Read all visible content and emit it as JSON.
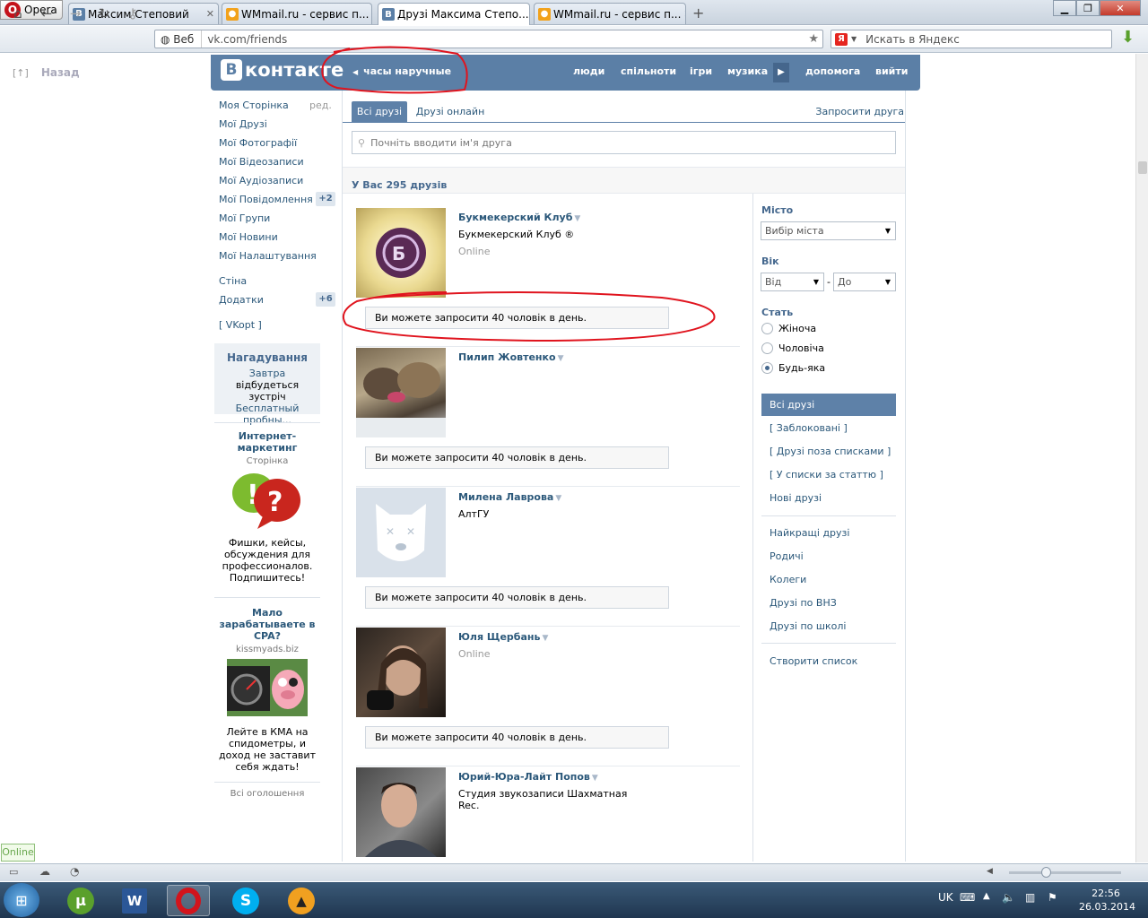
{
  "browser": {
    "opera_label": "Opera",
    "tabs": [
      {
        "title": "Максим Степовий",
        "icon": "vk"
      },
      {
        "title": "WMmail.ru - сервис п...",
        "icon": "wmmail"
      },
      {
        "title": "Друзі Максима Степо...",
        "icon": "vk"
      },
      {
        "title": "WMmail.ru - сервис п...",
        "icon": "wmmail"
      }
    ],
    "veb_label": "Веб",
    "url": "vk.com/friends",
    "search_placeholder": "Искать в Яндекс",
    "back_text": "Назад"
  },
  "vk": {
    "logo": "контакте",
    "search_query": "часы наручные",
    "topnav": [
      "люди",
      "спільноти",
      "ігри",
      "музика",
      "допомога",
      "вийти"
    ],
    "left_menu": [
      {
        "label": "Моя Сторінка",
        "extra": "ред."
      },
      {
        "label": "Мої Друзі"
      },
      {
        "label": "Мої Фотографії"
      },
      {
        "label": "Мої Відеозаписи"
      },
      {
        "label": "Мої Аудіозаписи"
      },
      {
        "label": "Мої Повідомлення",
        "count": "+2"
      },
      {
        "label": "Мої Групи"
      },
      {
        "label": "Мої Новини"
      },
      {
        "label": "Мої Налаштування"
      }
    ],
    "left_menu2": [
      {
        "label": "Стіна"
      },
      {
        "label": "Додатки",
        "count": "+6"
      },
      {
        "label": "[ VKopt ]"
      }
    ],
    "reminder": {
      "title": "Нагадування",
      "link1": "Завтра",
      "text": "відбудеться зустріч",
      "link2": "Бесплатный пробны..."
    },
    "ads": [
      {
        "title": "Интернет-маркетинг",
        "sub": "Сторінка",
        "text": "Фишки, кейсы, обсуждения для профессионалов. Подпишитесь!"
      },
      {
        "title": "Мало зарабатываете в CPA?",
        "sub": "kissmyads.biz",
        "text": "Лейте в КМА на спидометры, и доход не заставит себя ждать!"
      }
    ],
    "all_ads": "Всі оголошення",
    "tabs": {
      "all": "Всі друзі",
      "online": "Друзі онлайн",
      "invite": "Запросити друга"
    },
    "friend_search_placeholder": "Почніть вводити ім'я друга",
    "count_text": "У Вас 295 друзів",
    "invite_text": "Ви можете запросити 40 чоловік в день.",
    "friends": [
      {
        "name": "Букмекерский Клуб",
        "sub": "Букмекерский Клуб ®",
        "online": "Online"
      },
      {
        "name": "Пилип Жовтенко",
        "sub": "",
        "online": ""
      },
      {
        "name": "Милена Лаврова",
        "sub": "АлтГУ",
        "online": ""
      },
      {
        "name": "Юля Щербань",
        "sub": "",
        "online": "Online"
      },
      {
        "name": "Юрий-Юра-Лайт Попов",
        "sub": "Студия звукозаписи Шахматная Rec.",
        "online": ""
      }
    ],
    "filters": {
      "city_label": "Місто",
      "city_placeholder": "Вибір міста",
      "age_label": "Вік",
      "age_from": "Від",
      "age_dash": "-",
      "age_to": "До",
      "sex_label": "Стать",
      "sex_options": [
        "Жіноча",
        "Чоловіча",
        "Будь-яка"
      ],
      "sex_selected": "Будь-яка"
    },
    "lists": [
      "Всі друзі",
      "[ Заблоковані ]",
      "[ Друзі поза списками ]",
      "[ У списки за статтю ]",
      "Нові друзі"
    ],
    "lists2": [
      "Найкращі друзі",
      "Родичі",
      "Колеги",
      "Друзі по ВНЗ",
      "Друзі по школі"
    ],
    "create_list": "Створити список",
    "online_badge": "Online"
  },
  "taskbar": {
    "lang": "UK",
    "time": "22:56",
    "date": "26.03.2014"
  },
  "colors": {
    "vk_header": "#5b7fa6",
    "vk_link": "#2b587a",
    "annotation_red": "#e0141e"
  }
}
